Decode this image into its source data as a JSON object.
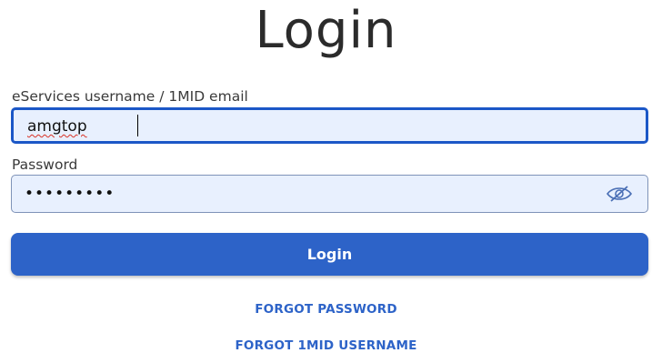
{
  "title": "Login",
  "username": {
    "label": "eServices username / 1MID email",
    "value": "amgtop"
  },
  "password": {
    "label": "Password",
    "masked_value": "•••••••••",
    "toggle_icon": "eye-slash-icon"
  },
  "login_button": {
    "label": "Login"
  },
  "links": {
    "forgot_password": "FORGOT PASSWORD",
    "forgot_username": "FORGOT 1MID USERNAME"
  },
  "colors": {
    "accent": "#2d63c8",
    "input_background": "#e8f0fe",
    "focus_border": "#1b57c7"
  }
}
